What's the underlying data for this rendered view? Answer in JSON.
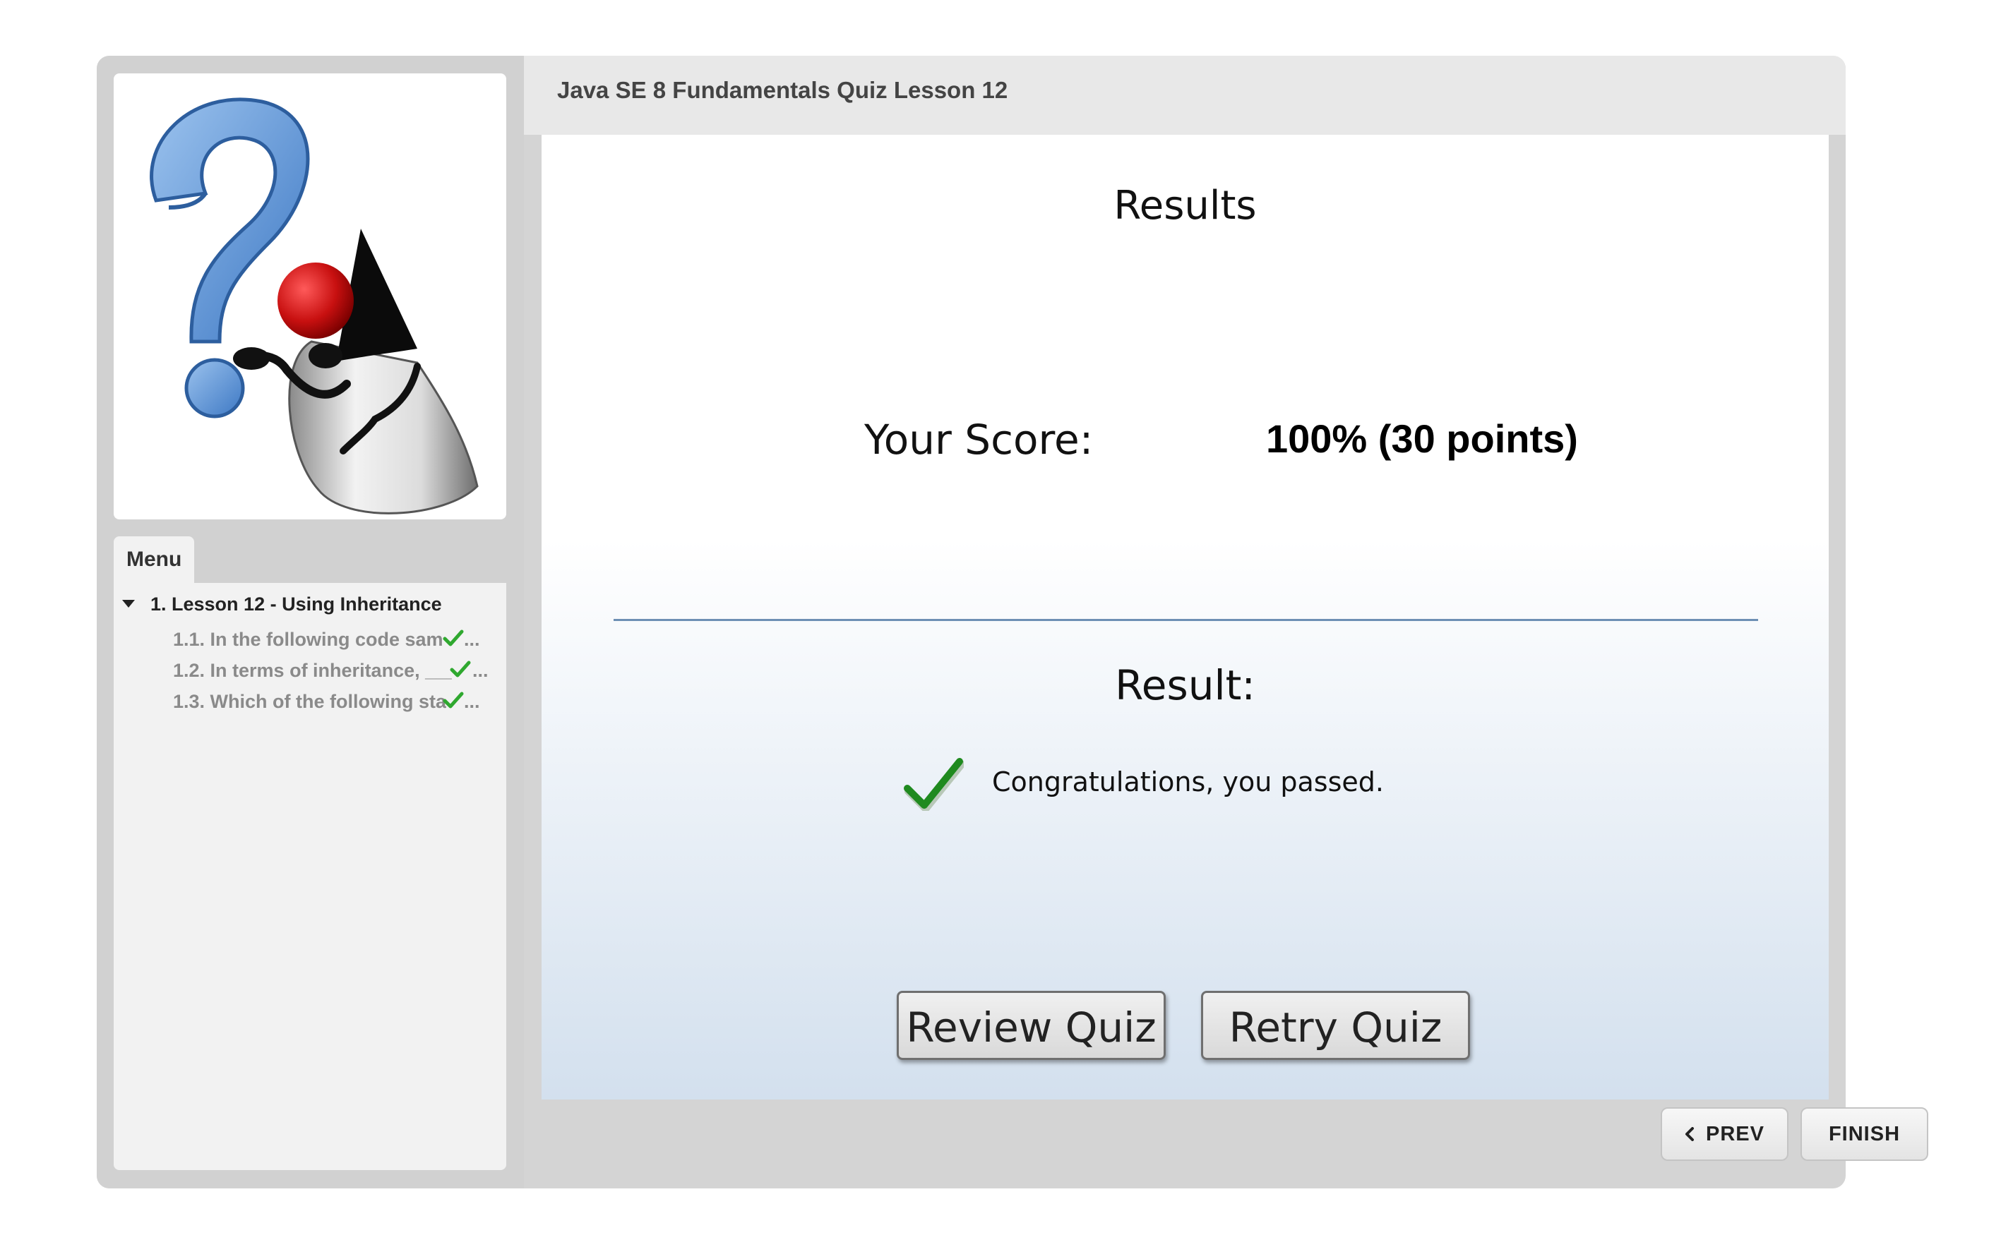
{
  "header": {
    "quiz_title": "Java SE 8 Fundamentals Quiz Lesson 12"
  },
  "sidebar": {
    "menu_tab_label": "Menu",
    "lesson": {
      "label": "1. Lesson 12 - Using Inheritance",
      "expanded": true
    },
    "questions": [
      {
        "label": "1.1. In the following code sam",
        "status": "correct",
        "ellipsis": "..."
      },
      {
        "label": "1.2. In terms of inheritance, ___",
        "status": "correct",
        "ellipsis": "..."
      },
      {
        "label": "1.3. Which of the following sta",
        "status": "correct",
        "ellipsis": "..."
      }
    ]
  },
  "results": {
    "title": "Results",
    "score_label": "Your Score:",
    "score_value": "100% (30 points)",
    "result_label": "Result:",
    "pass_message": "Congratulations, you passed.",
    "review_button": "Review Quiz",
    "retry_button": "Retry Quiz"
  },
  "nav": {
    "prev_label": "PREV",
    "finish_label": "FINISH"
  },
  "colors": {
    "check_green": "#2fa82f",
    "pass_check_green": "#1f8a1f",
    "divider_blue": "#6d8fb4"
  }
}
